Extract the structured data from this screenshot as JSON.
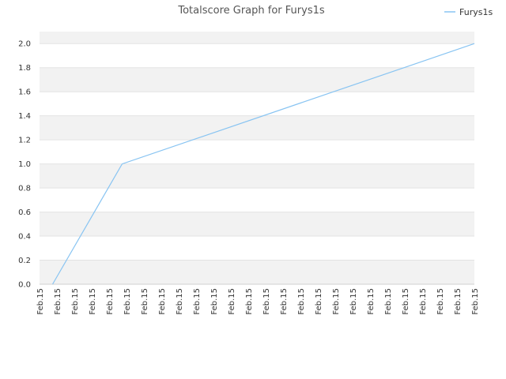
{
  "chart_data": {
    "type": "line",
    "title": "Totalscore Graph for Furys1s",
    "xlabel": "",
    "ylabel": "",
    "ylim": [
      0,
      2.1
    ],
    "y_ticks": [
      "0.0",
      "0.2",
      "0.4",
      "0.6",
      "0.8",
      "1.0",
      "1.2",
      "1.4",
      "1.6",
      "1.8",
      "2.0"
    ],
    "y_tick_values": [
      0,
      0.2,
      0.4,
      0.6,
      0.8,
      1.0,
      1.2,
      1.4,
      1.6,
      1.8,
      2.0
    ],
    "x_tick_labels": [
      "Feb.15",
      "Feb.15",
      "Feb.15",
      "Feb.15",
      "Feb.15",
      "Feb.15",
      "Feb.15",
      "Feb.15",
      "Feb.15",
      "Feb.15",
      "Feb.15",
      "Feb.15",
      "Feb.15",
      "Feb.15",
      "Feb.15",
      "Feb.15",
      "Feb.15",
      "Feb.15",
      "Feb.15",
      "Feb.15",
      "Feb.15",
      "Feb.15",
      "Feb.15",
      "Feb.15",
      "Feb.15",
      "Feb.15"
    ],
    "grid": "horizontal alternating bands",
    "legend_position": "top-right",
    "series": [
      {
        "name": "Furys1s",
        "color": "#88c4f2",
        "x": [
          0.75,
          4.75,
          25
        ],
        "values": [
          0,
          1.0,
          2.0
        ]
      }
    ],
    "colors": {
      "band": "#f2f2f2",
      "grid": "#e3e3e3",
      "axis": "#d0d0d0"
    }
  }
}
